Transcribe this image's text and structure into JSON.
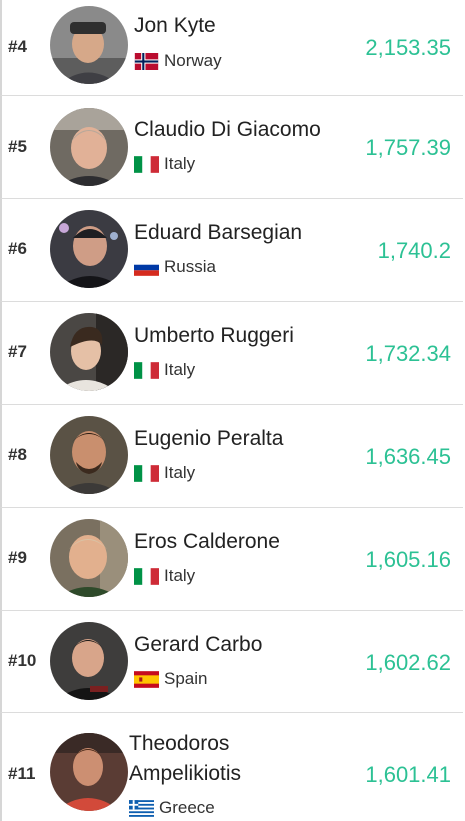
{
  "leaderboard": [
    {
      "rank": "#4",
      "name": "Jon Kyte",
      "country": "Norway",
      "flag": "norway-flag-icon",
      "score": "2,153.35",
      "avatar_bg": "#8a8a8a",
      "skin": "#d6a889"
    },
    {
      "rank": "#5",
      "name": "Claudio Di Giacomo",
      "country": "Italy",
      "flag": "italy-flag-icon",
      "score": "1,757.39",
      "avatar_bg": "#6f6a62",
      "skin": "#e1b197"
    },
    {
      "rank": "#6",
      "name": "Eduard Barsegian",
      "country": "Russia",
      "flag": "russia-flag-icon",
      "score": "1,740.2",
      "avatar_bg": "#3b3b42",
      "skin": "#cf9d86"
    },
    {
      "rank": "#7",
      "name": "Umberto Ruggeri",
      "country": "Italy",
      "flag": "italy-flag-icon",
      "score": "1,732.34",
      "avatar_bg": "#4a4744",
      "skin": "#e5c0a6"
    },
    {
      "rank": "#8",
      "name": "Eugenio Peralta",
      "country": "Italy",
      "flag": "italy-flag-icon",
      "score": "1,636.45",
      "avatar_bg": "#5a5245",
      "skin": "#c98f6e"
    },
    {
      "rank": "#9",
      "name": "Eros Calderone",
      "country": "Italy",
      "flag": "italy-flag-icon",
      "score": "1,605.16",
      "avatar_bg": "#7a7060",
      "skin": "#e2b08e"
    },
    {
      "rank": "#10",
      "name": "Gerard Carbo",
      "country": "Spain",
      "flag": "spain-flag-icon",
      "score": "1,602.62",
      "avatar_bg": "#3e3d3c",
      "skin": "#d8a58a"
    },
    {
      "rank": "#11",
      "name": "Theodoros Ampelikiotis",
      "country": "Greece",
      "flag": "greece-flag-icon",
      "score": "1,601.41",
      "avatar_bg": "#5a3c34",
      "skin": "#cc8f72"
    }
  ],
  "colors": {
    "score": "#2cc194",
    "divider": "#dcdcdc"
  }
}
